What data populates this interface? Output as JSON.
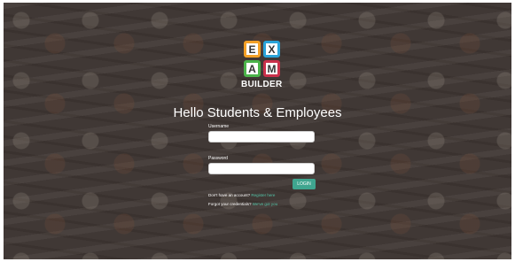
{
  "logo": {
    "tiles": [
      "E",
      "X",
      "A",
      "M"
    ],
    "word": "BUILDER",
    "colors": {
      "e": "#f3a027",
      "x": "#2aa3d8",
      "a": "#4bb34a",
      "m": "#c9304a"
    }
  },
  "heading": "Hello Students & Employees",
  "form": {
    "username_label": "Username",
    "username_value": "",
    "password_label": "Password",
    "password_value": "",
    "login_label": "LOGIN"
  },
  "links": {
    "no_account_text": "Don't have an account?",
    "register_link": "Register here",
    "forgot_text": "Forgot your credentials?",
    "forgot_link": "We've got you"
  },
  "colors": {
    "accent": "#3fa58f",
    "link": "#55c4a8"
  }
}
